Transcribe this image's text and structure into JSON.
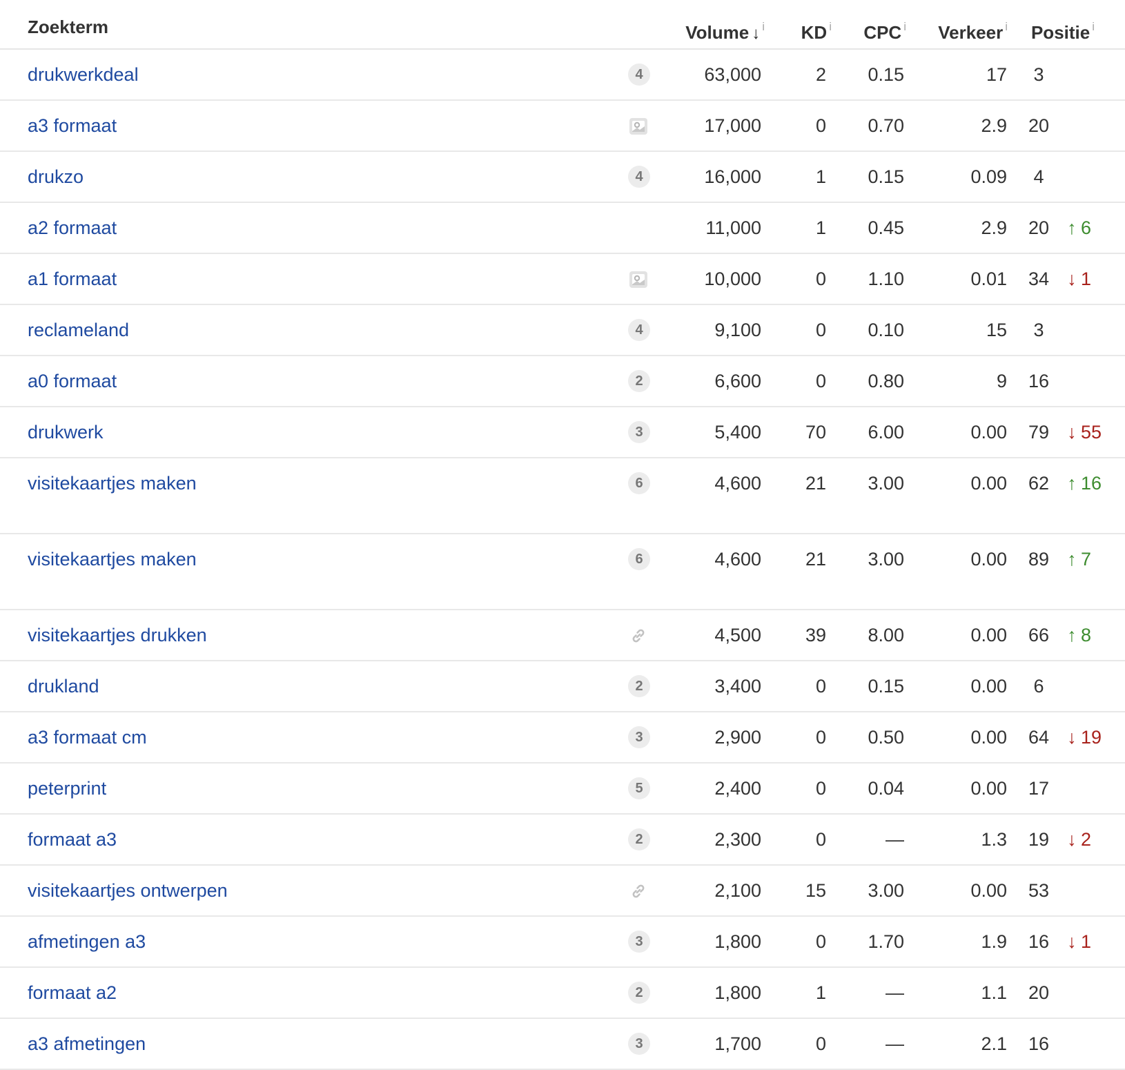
{
  "header": {
    "keyword": "Zoekterm",
    "volume": "Volume",
    "kd": "KD",
    "cpc": "CPC",
    "traffic": "Verkeer",
    "position": "Positie",
    "info": "i",
    "sort_arrow": "↓"
  },
  "rows": [
    {
      "keyword": "drukwerkdeal",
      "feature": "4",
      "feature_type": "badge",
      "volume": "63,000",
      "kd": "2",
      "cpc": "0.15",
      "traffic": "17",
      "position": "3",
      "change": "",
      "change_dir": ""
    },
    {
      "keyword": "a3 formaat",
      "feature": "",
      "feature_type": "image-icon",
      "volume": "17,000",
      "kd": "0",
      "cpc": "0.70",
      "traffic": "2.9",
      "position": "20",
      "change": "",
      "change_dir": ""
    },
    {
      "keyword": "drukzo",
      "feature": "4",
      "feature_type": "badge",
      "volume": "16,000",
      "kd": "1",
      "cpc": "0.15",
      "traffic": "0.09",
      "position": "4",
      "change": "",
      "change_dir": ""
    },
    {
      "keyword": "a2 formaat",
      "feature": "",
      "feature_type": "none",
      "volume": "11,000",
      "kd": "1",
      "cpc": "0.45",
      "traffic": "2.9",
      "position": "20",
      "change": "6",
      "change_dir": "up"
    },
    {
      "keyword": "a1 formaat",
      "feature": "",
      "feature_type": "image-icon",
      "volume": "10,000",
      "kd": "0",
      "cpc": "1.10",
      "traffic": "0.01",
      "position": "34",
      "change": "1",
      "change_dir": "down"
    },
    {
      "keyword": "reclameland",
      "feature": "4",
      "feature_type": "badge",
      "volume": "9,100",
      "kd": "0",
      "cpc": "0.10",
      "traffic": "15",
      "position": "3",
      "change": "",
      "change_dir": ""
    },
    {
      "keyword": "a0 formaat",
      "feature": "2",
      "feature_type": "badge",
      "volume": "6,600",
      "kd": "0",
      "cpc": "0.80",
      "traffic": "9",
      "position": "16",
      "change": "",
      "change_dir": ""
    },
    {
      "keyword": "drukwerk",
      "feature": "3",
      "feature_type": "badge",
      "volume": "5,400",
      "kd": "70",
      "cpc": "6.00",
      "traffic": "0.00",
      "position": "79",
      "change": "55",
      "change_dir": "down"
    },
    {
      "keyword": "visitekaartjes maken",
      "feature": "6",
      "feature_type": "badge",
      "volume": "4,600",
      "kd": "21",
      "cpc": "3.00",
      "traffic": "0.00",
      "position": "62",
      "change": "16",
      "change_dir": "up",
      "tall": true
    },
    {
      "keyword": "visitekaartjes maken",
      "feature": "6",
      "feature_type": "badge",
      "volume": "4,600",
      "kd": "21",
      "cpc": "3.00",
      "traffic": "0.00",
      "position": "89",
      "change": "7",
      "change_dir": "up",
      "tall": true
    },
    {
      "keyword": "visitekaartjes drukken",
      "feature": "",
      "feature_type": "link-icon",
      "volume": "4,500",
      "kd": "39",
      "cpc": "8.00",
      "traffic": "0.00",
      "position": "66",
      "change": "8",
      "change_dir": "up"
    },
    {
      "keyword": "drukland",
      "feature": "2",
      "feature_type": "badge",
      "volume": "3,400",
      "kd": "0",
      "cpc": "0.15",
      "traffic": "0.00",
      "position": "6",
      "change": "",
      "change_dir": ""
    },
    {
      "keyword": "a3 formaat cm",
      "feature": "3",
      "feature_type": "badge",
      "volume": "2,900",
      "kd": "0",
      "cpc": "0.50",
      "traffic": "0.00",
      "position": "64",
      "change": "19",
      "change_dir": "down"
    },
    {
      "keyword": "peterprint",
      "feature": "5",
      "feature_type": "badge",
      "volume": "2,400",
      "kd": "0",
      "cpc": "0.04",
      "traffic": "0.00",
      "position": "17",
      "change": "",
      "change_dir": ""
    },
    {
      "keyword": "formaat a3",
      "feature": "2",
      "feature_type": "badge",
      "volume": "2,300",
      "kd": "0",
      "cpc": "—",
      "traffic": "1.3",
      "position": "19",
      "change": "2",
      "change_dir": "down"
    },
    {
      "keyword": "visitekaartjes ontwerpen",
      "feature": "",
      "feature_type": "link-icon",
      "volume": "2,100",
      "kd": "15",
      "cpc": "3.00",
      "traffic": "0.00",
      "position": "53",
      "change": "",
      "change_dir": ""
    },
    {
      "keyword": "afmetingen a3",
      "feature": "3",
      "feature_type": "badge",
      "volume": "1,800",
      "kd": "0",
      "cpc": "1.70",
      "traffic": "1.9",
      "position": "16",
      "change": "1",
      "change_dir": "down"
    },
    {
      "keyword": "formaat a2",
      "feature": "2",
      "feature_type": "badge",
      "volume": "1,800",
      "kd": "1",
      "cpc": "—",
      "traffic": "1.1",
      "position": "20",
      "change": "",
      "change_dir": ""
    },
    {
      "keyword": "a3 afmetingen",
      "feature": "3",
      "feature_type": "badge",
      "volume": "1,700",
      "kd": "0",
      "cpc": "—",
      "traffic": "2.1",
      "position": "16",
      "change": "",
      "change_dir": ""
    }
  ],
  "colors": {
    "link": "#1f4aa0",
    "up": "#3d8c2f",
    "down": "#a8221c",
    "text": "#333333",
    "border": "#e8e8e8"
  }
}
